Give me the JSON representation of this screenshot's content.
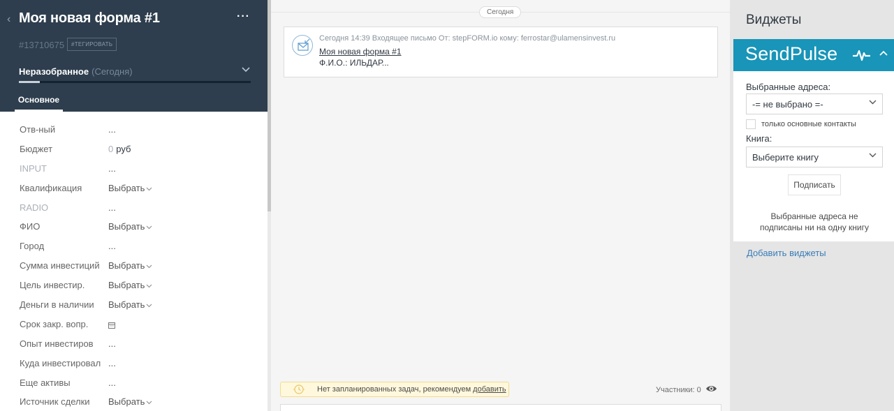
{
  "lead": {
    "title": "Моя новая форма #1",
    "more": "···",
    "id": "#13710675",
    "tag_button": "#ТЕГИРОВАТЬ",
    "pipeline": "Неразобранное",
    "pipeline_date": "(Сегодня)",
    "progress": 0.09,
    "tab": "Основное"
  },
  "fields": [
    {
      "label": "Отв-ный",
      "value": "..."
    },
    {
      "label": "Бюджет",
      "value": "0",
      "currency": "руб"
    },
    {
      "label": "INPUT",
      "value": "...",
      "muted": true
    },
    {
      "label": "Квалификация",
      "value": "Выбрать",
      "dropdown": true
    },
    {
      "label": "RADIO",
      "value": "...",
      "muted": true
    },
    {
      "label": "ФИО",
      "value": "Выбрать",
      "dropdown": true
    },
    {
      "label": "Город",
      "value": "..."
    },
    {
      "label": "Сумма инвестиций",
      "value": "Выбрать",
      "dropdown": true
    },
    {
      "label": "Цель инвестир.",
      "value": "Выбрать",
      "dropdown": true
    },
    {
      "label": "Деньги в наличии",
      "value": "Выбрать",
      "dropdown": true
    },
    {
      "label": "Срок закр. вопр.",
      "value": "calendar-icon",
      "calendar": true
    },
    {
      "label": "Опыт инвестиров",
      "value": "..."
    },
    {
      "label": "Куда инвестировали",
      "value": "..."
    },
    {
      "label": "Еще активы",
      "value": "..."
    },
    {
      "label": "Источник сделки",
      "value": "Выбрать",
      "dropdown": true
    }
  ],
  "feed": {
    "date_pill": "Сегодня",
    "note": {
      "meta": "Сегодня 14:39 Входящее письмо От: stepFORM.io кому: ferrostar@ulamensinvest.ru",
      "subject": "Моя новая форма #1",
      "body": "Ф.И.О.: ИЛЬДАР..."
    },
    "task_text": "Нет запланированных задач, рекомендуем",
    "task_link": "добавить",
    "participants": "Участники: 0"
  },
  "widgets": {
    "title": "Виджеты",
    "sendpulse": {
      "logo": "SendPulse",
      "addresses_label": "Выбранные адреса:",
      "addresses_value": "-= не выбрано =-",
      "only_main_label": "только основные контакты",
      "book_label": "Книга:",
      "book_value": "Выберите книгу",
      "subscribe_button": "Подписать",
      "note": "Выбранные адреса не подписаны ни на одну книгу"
    },
    "add_link": "Добавить виджеты"
  },
  "colors": {
    "header_bg": "#2e3e4e",
    "sendpulse_bg": "#1895b8",
    "link": "#3a7db8",
    "task_bg": "#fff8dc"
  }
}
